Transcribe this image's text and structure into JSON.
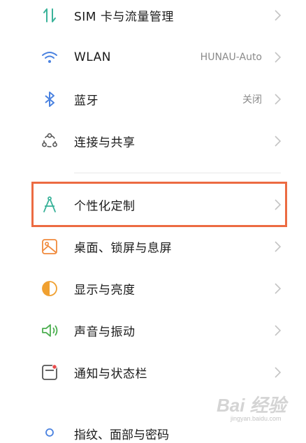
{
  "settings": {
    "items": [
      {
        "label": "SIM 卡与流量管理",
        "value": "",
        "icon": "sim-data-icon",
        "color": "#3bb39a"
      },
      {
        "label": "WLAN",
        "value": "HUNAU-Auto",
        "icon": "wifi-icon",
        "color": "#4a82e0"
      },
      {
        "label": "蓝牙",
        "value": "关闭",
        "icon": "bluetooth-icon",
        "color": "#4a82e0"
      },
      {
        "label": "连接与共享",
        "value": "",
        "icon": "connection-share-icon",
        "color": "#555555"
      },
      {
        "label": "个性化定制",
        "value": "",
        "icon": "personalization-icon",
        "color": "#3bb39a"
      },
      {
        "label": "桌面、锁屏与息屏",
        "value": "",
        "icon": "wallpaper-icon",
        "color": "#f08a3c"
      },
      {
        "label": "显示与亮度",
        "value": "",
        "icon": "display-brightness-icon",
        "color": "#f0a030"
      },
      {
        "label": "声音与振动",
        "value": "",
        "icon": "sound-vibration-icon",
        "color": "#4caf50"
      },
      {
        "label": "通知与状态栏",
        "value": "",
        "icon": "notification-statusbar-icon",
        "color": "#e94b4b"
      }
    ],
    "partial_label": "指纹、面部与密码"
  },
  "highlight_color": "#ec6b42",
  "watermark": {
    "brand": "Bai 经验",
    "sub": "jingyan.baidu.com"
  }
}
